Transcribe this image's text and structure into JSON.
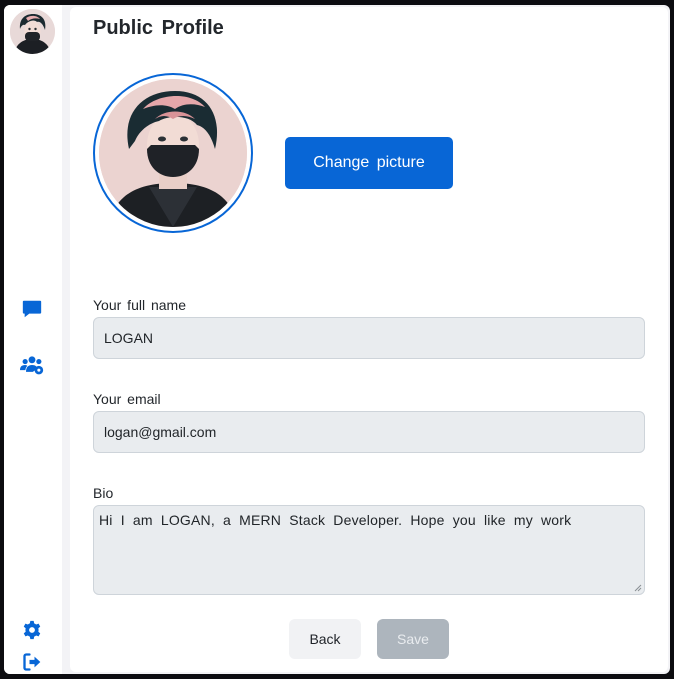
{
  "sidebar": {
    "avatar_icon": "user-avatar",
    "items": [
      {
        "icon": "chat-icon",
        "name": "chat"
      },
      {
        "icon": "users-settings-icon",
        "name": "groups"
      },
      {
        "icon": "gear-icon",
        "name": "settings"
      },
      {
        "icon": "logout-icon",
        "name": "logout"
      }
    ],
    "accent_color": "#0866d6"
  },
  "profile": {
    "title": "Public Profile",
    "change_picture_label": "Change picture",
    "full_name_label": "Your full name",
    "full_name_value": "LOGAN",
    "email_label": "Your email",
    "email_value": "logan@gmail.com",
    "bio_label": "Bio",
    "bio_value": "Hi I am LOGAN, a MERN Stack Developer. Hope you like my work",
    "back_label": "Back",
    "save_label": "Save"
  },
  "colors": {
    "primary": "#0866d6",
    "save_disabled": "#adb5bd",
    "input_bg": "#e9ecef"
  }
}
